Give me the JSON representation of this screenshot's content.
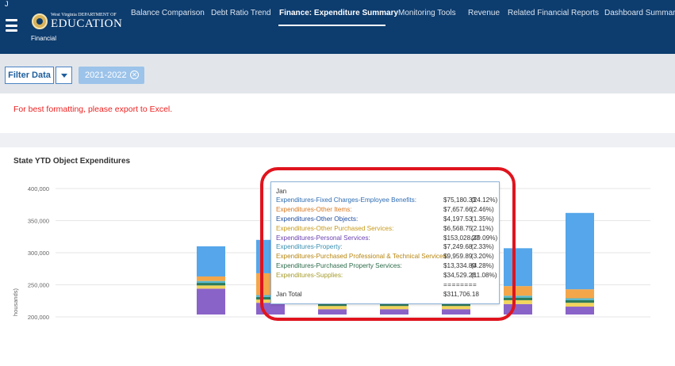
{
  "header": {
    "corner_letter": "J",
    "logo_small": "West Virginia DEPARTMENT OF",
    "logo_big": "EDUCATION",
    "logo_sub": "Financial",
    "tabs": [
      {
        "label": "Balance Comparison"
      },
      {
        "label": "Debt Ratio Trend"
      },
      {
        "label": "Finance: Expenditure Summary"
      },
      {
        "label": "Monitoring Tools"
      },
      {
        "label": "Revenue"
      },
      {
        "label": "Related Financial Reports"
      },
      {
        "label": "Dashboard Summary"
      }
    ],
    "active_tab_index": 2
  },
  "filter": {
    "button_label": "Filter Data",
    "chip_label": "2021-2022",
    "chip_close": "✕"
  },
  "warning": "For best formatting, please export to Excel.",
  "chart": {
    "title": "State YTD Object Expenditures",
    "ylabel": "housands)",
    "yticks": [
      "400,000",
      "350,000",
      "300,000",
      "250,000",
      "200,000"
    ]
  },
  "chart_data": {
    "type": "bar",
    "stacked": true,
    "ylim": [
      175000,
      400000
    ],
    "ytick_values": [
      400000,
      350000,
      300000,
      250000,
      200000
    ],
    "categories": [
      "Jan",
      "",
      "",
      "",
      "",
      "",
      ""
    ],
    "series": [
      {
        "name": "Expenditures-Personal Services",
        "color": "#8a63c8",
        "values": [
          244000,
          222000,
          212000,
          212000,
          212000,
          220000,
          216000
        ]
      },
      {
        "name": "Expenditures-Supplies",
        "color": "#f2d45c",
        "values": [
          5000,
          5000,
          5000,
          5000,
          5000,
          6000,
          6000
        ]
      },
      {
        "name": "Expenditures-Purchased Property Services",
        "color": "#2c7b5a",
        "values": [
          4000,
          4000,
          4000,
          4000,
          4000,
          4000,
          4000
        ]
      },
      {
        "name": "Expenditures-Property",
        "color": "#58b9cf",
        "values": [
          3000,
          3000,
          3000,
          3000,
          3000,
          3000,
          3000
        ]
      },
      {
        "name": "Expenditures-Other Items",
        "color": "#f4a64a",
        "values": [
          7000,
          34000,
          30000,
          30000,
          30000,
          15000,
          14000
        ]
      },
      {
        "name": "Expenditures-Fixed Charges-Employee Benefits",
        "color": "#55a6ea",
        "values": [
          47000,
          52000,
          50000,
          51000,
          52000,
          59000,
          119000
        ]
      }
    ]
  },
  "tooltip": {
    "month": "Jan",
    "rows": [
      {
        "label": "Expenditures-Fixed Charges-Employee Benefits:",
        "amount": "$75,180.33",
        "pct": "(24.12%)",
        "color": "#2f6db3"
      },
      {
        "label": "Expenditures-Other Items:",
        "amount": "$7,657.66",
        "pct": "(2.46%)",
        "color": "#d9781e"
      },
      {
        "label": "Expenditures-Other Objects:",
        "amount": "$4,197.53",
        "pct": "(1.35%)",
        "color": "#1f4fa0"
      },
      {
        "label": "Expenditures-Other Purchased Services:",
        "amount": "$6,568.75",
        "pct": "(2.11%)",
        "color": "#c79a19"
      },
      {
        "label": "Expenditures-Personal Services:",
        "amount": "$153,028.27",
        "pct": "(49.09%)",
        "color": "#6a3fb0"
      },
      {
        "label": "Expenditures-Property:",
        "amount": "$7,249.68",
        "pct": "(2.33%)",
        "color": "#3a8fb0"
      },
      {
        "label": "Expenditures-Purchased Professional & Technical Services:",
        "amount": "$9,959.89",
        "pct": "(3.20%)",
        "color": "#b78610"
      },
      {
        "label": "Expenditures-Purchased Property Services:",
        "amount": "$13,334.80",
        "pct": "(4.28%)",
        "color": "#2c6b4a"
      },
      {
        "label": "Expenditures-Supplies:",
        "amount": "$34,529.28",
        "pct": "(11.08%)",
        "color": "#a59b2a"
      }
    ],
    "separator": "========",
    "total_label": "Jan Total",
    "total_amount": "$311,706.18"
  },
  "colors": {
    "header_bg": "#0d3c6e",
    "accent": "#4a84c4",
    "warning": "#ee2222",
    "highlight": "#e0141e"
  }
}
